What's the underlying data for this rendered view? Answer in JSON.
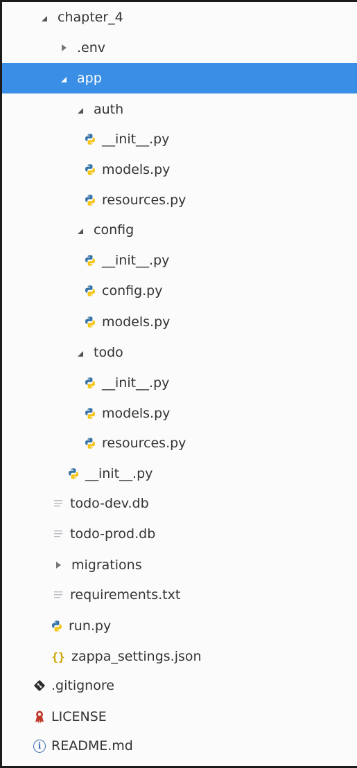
{
  "tree": {
    "rows": [
      {
        "label": "chapter_4",
        "kind": "folder-open",
        "icon": "triangle-down-icon"
      },
      {
        "label": ".env",
        "kind": "folder-closed",
        "icon": "triangle-right-icon"
      },
      {
        "label": "app",
        "kind": "folder-open",
        "icon": "triangle-down-icon",
        "selected": true
      },
      {
        "label": "auth",
        "kind": "folder-open",
        "icon": "triangle-down-icon"
      },
      {
        "label": "__init__.py",
        "kind": "python",
        "icon": "python-icon"
      },
      {
        "label": "models.py",
        "kind": "python",
        "icon": "python-icon"
      },
      {
        "label": "resources.py",
        "kind": "python",
        "icon": "python-icon"
      },
      {
        "label": "config",
        "kind": "folder-open",
        "icon": "triangle-down-icon"
      },
      {
        "label": "__init__.py",
        "kind": "python",
        "icon": "python-icon"
      },
      {
        "label": "config.py",
        "kind": "python",
        "icon": "python-icon"
      },
      {
        "label": "models.py",
        "kind": "python",
        "icon": "python-icon"
      },
      {
        "label": "todo",
        "kind": "folder-open",
        "icon": "triangle-down-icon"
      },
      {
        "label": "__init__.py",
        "kind": "python",
        "icon": "python-icon"
      },
      {
        "label": "models.py",
        "kind": "python",
        "icon": "python-icon"
      },
      {
        "label": "resources.py",
        "kind": "python",
        "icon": "python-icon"
      },
      {
        "label": "__init__.py",
        "kind": "python",
        "icon": "python-icon"
      },
      {
        "label": "todo-dev.db",
        "kind": "text",
        "icon": "text-file-icon"
      },
      {
        "label": "todo-prod.db",
        "kind": "text",
        "icon": "text-file-icon"
      },
      {
        "label": "migrations",
        "kind": "folder-closed",
        "icon": "triangle-right-icon"
      },
      {
        "label": "requirements.txt",
        "kind": "text",
        "icon": "text-file-icon"
      },
      {
        "label": "run.py",
        "kind": "python",
        "icon": "python-icon"
      },
      {
        "label": "zappa_settings.json",
        "kind": "json",
        "icon": "json-braces-icon"
      },
      {
        "label": ".gitignore",
        "kind": "git",
        "icon": "git-diamond-icon"
      },
      {
        "label": "LICENSE",
        "kind": "license",
        "icon": "license-ribbon-icon"
      },
      {
        "label": "README.md",
        "kind": "info",
        "icon": "info-circle-icon"
      }
    ]
  },
  "colors": {
    "selection": "#3a8ee6",
    "python_blue": "#3572a5",
    "python_yellow": "#f5c518",
    "json_yellow": "#c9a400",
    "license_red": "#c0392b",
    "info_blue": "#3a6fb0"
  }
}
